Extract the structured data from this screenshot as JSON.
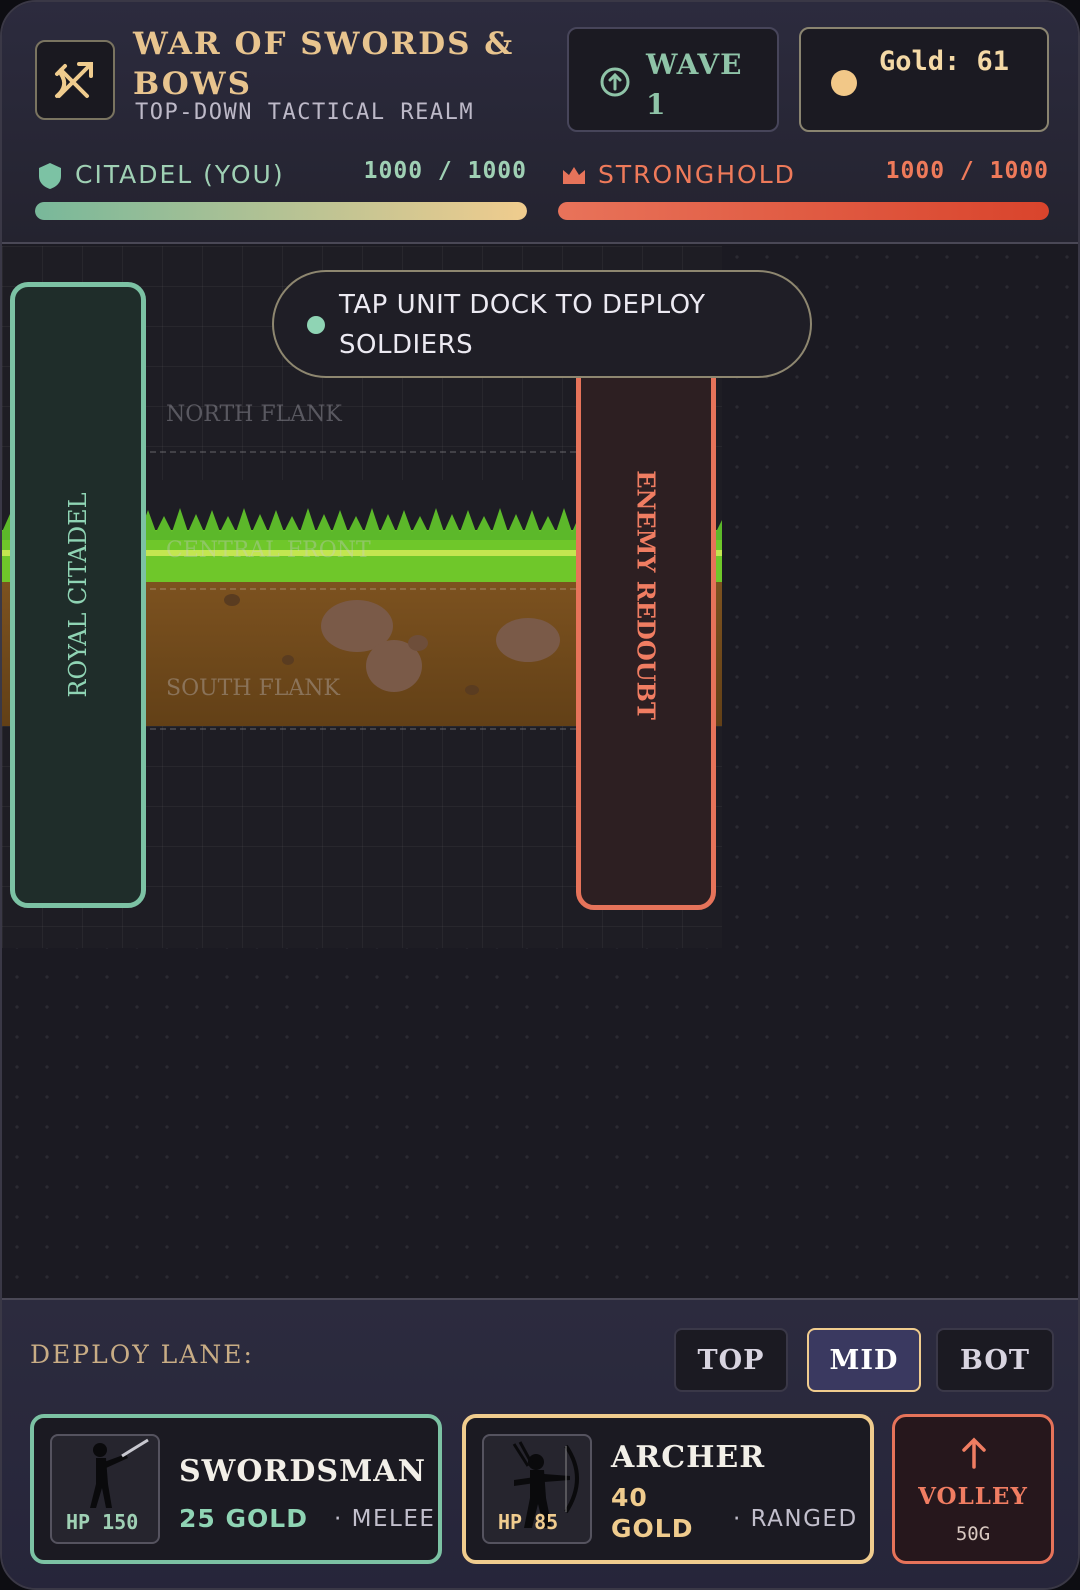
{
  "header": {
    "title": "WAR OF SWORDS & BOWS",
    "subtitle": "TOP-DOWN TACTICAL REALM",
    "logo_icon": "crossed-sword-bow-icon",
    "wave_label": "WAVE 1",
    "wave_icon": "arrow-up-circle-icon",
    "gold_label": "Gold: 61",
    "gold_icon": "coin-icon"
  },
  "health": {
    "player": {
      "name": "CITADEL (YOU)",
      "value_text": "1000 / 1000",
      "current": 1000,
      "max": 1000,
      "icon": "shield-icon",
      "color": "#7cc2a4"
    },
    "enemy": {
      "name": "STRONGHOLD",
      "value_text": "1000 / 1000",
      "current": 1000,
      "max": 1000,
      "icon": "crown-icon",
      "color": "#e6735a"
    }
  },
  "battlefield": {
    "toast": "TAP UNIT DOCK TO DEPLOY SOLDIERS",
    "lanes": [
      "NORTH FLANK",
      "CENTRAL FRONT",
      "SOUTH FLANK"
    ],
    "player_base": "ROYAL CITADEL",
    "enemy_base": "ENEMY REDOUBT"
  },
  "dock": {
    "lane_title": "DEPLOY LANE:",
    "lane_buttons": [
      "TOP",
      "MID",
      "BOT"
    ],
    "selected_lane": "MID",
    "units": [
      {
        "name": "SWORDSMAN",
        "cost": "25 GOLD",
        "role": "· MELEE",
        "hp": "HP 150",
        "icon": "swordsman-silhouette-icon"
      },
      {
        "name": "ARCHER",
        "cost": "40 GOLD",
        "role": "· RANGED",
        "hp": "HP 85",
        "icon": "archer-silhouette-icon"
      }
    ],
    "volley": {
      "name": "VOLLEY",
      "cost": "50G",
      "icon": "arrow-up-icon"
    }
  },
  "colors": {
    "accent_gold": "#f0cc8e",
    "player_green": "#7cc2a4",
    "enemy_red": "#e6735a",
    "background": "#1b1a22"
  }
}
